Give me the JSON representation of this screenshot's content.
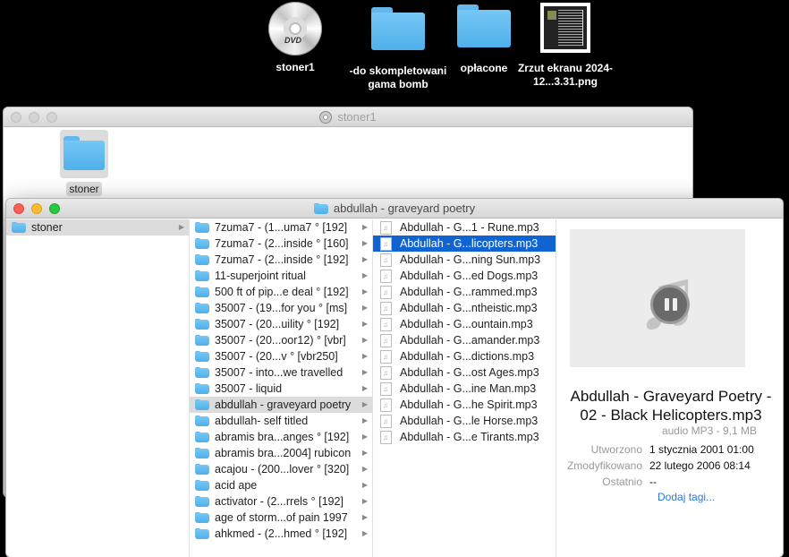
{
  "desktop": {
    "icons": [
      {
        "label": "stoner1",
        "icon": "dvd-icon",
        "disc_label": "DVD"
      },
      {
        "label": "-do skompletowani gama bomb",
        "icon": "folder-icon"
      },
      {
        "label": "opłacone",
        "icon": "folder-icon"
      },
      {
        "label": "Zrzut ekranu 2024-12...3.31.png",
        "icon": "image-thumbnail-icon"
      }
    ]
  },
  "back_window": {
    "title": "stoner1",
    "item_label": "stoner"
  },
  "front_window": {
    "title": "abdullah - graveyard poetry",
    "column1": [
      {
        "label": "stoner"
      }
    ],
    "column2": [
      "7zuma7 - (1...uma7 ° [192]",
      "7zuma7 - (2...inside ° [160]",
      "7zuma7 - (2...inside ° [192]",
      "11-superjoint ritual",
      "500 ft of pip...e deal ° [192]",
      "35007 - (19...for you ° [ms]",
      "35007 - (20...uility ° [192]",
      "35007 - (20...oor12) ° [vbr]",
      "35007 - (20...v ° [vbr250]",
      "35007 - into...we travelled",
      "35007 - liquid",
      "abdullah - graveyard poetry",
      "abdullah- self titled",
      "abramis bra...anges ° [192]",
      "abramis bra...2004] rubicon",
      "acajou - (200...lover ° [320]",
      "acid ape",
      "activator - (2...rrels ° [192]",
      "age of storm...of pain 1997",
      "ahkmed - (2...hmed ° [192]"
    ],
    "column2_selected_index": 11,
    "column3": [
      "Abdullah - G...1 - Rune.mp3",
      "Abdullah - G...licopters.mp3",
      "Abdullah - G...ning Sun.mp3",
      "Abdullah - G...ed Dogs.mp3",
      "Abdullah - G...rammed.mp3",
      "Abdullah - G...ntheistic.mp3",
      "Abdullah - G...ountain.mp3",
      "Abdullah - G...amander.mp3",
      "Abdullah - G...dictions.mp3",
      "Abdullah - G...ost Ages.mp3",
      "Abdullah - G...ine Man.mp3",
      "Abdullah - G...he Spirit.mp3",
      "Abdullah - G...le Horse.mp3",
      "Abdullah - G...e Tirants.mp3"
    ],
    "column3_selected_index": 1,
    "preview": {
      "title": "Abdullah - Graveyard Poetry - 02 - Black Helicopters.mp3",
      "subtitle": "audio MP3 - 9,1 MB",
      "meta": [
        {
          "key": "Utworzono",
          "value": "1 stycznia 2001 01:00"
        },
        {
          "key": "Zmodyfikowano",
          "value": "22 lutego 2006 08:14"
        },
        {
          "key": "Ostatnio",
          "value": "--"
        }
      ],
      "tags_link": "Dodaj tagi..."
    }
  },
  "colors": {
    "selection_blue": "#0f64d2",
    "folder_blue": "#5cb8ee",
    "link_blue": "#2a78e4"
  }
}
